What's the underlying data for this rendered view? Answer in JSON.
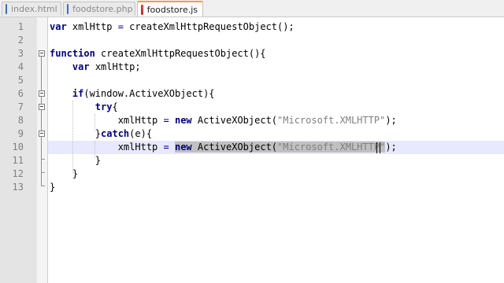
{
  "tabs": [
    {
      "label": "index.html",
      "icon": "document-icon",
      "active": false
    },
    {
      "label": "foodstore.php",
      "icon": "document-icon",
      "active": false
    },
    {
      "label": "foodstore.js",
      "icon": "document-icon",
      "active": true
    }
  ],
  "colors": {
    "keyword": "#000080",
    "string": "#808080",
    "current_line": "#e8e8ff",
    "selection": "#c0c0c0",
    "active_tab_accent": "#f0a040"
  },
  "current_line": 10,
  "lines": [
    {
      "n": "1",
      "segments": [
        {
          "t": "var ",
          "c": "kw"
        },
        {
          "t": "xmlHttp "
        },
        {
          "t": "=",
          "c": "op"
        },
        {
          "t": " createXmlHttpRequestObject();"
        }
      ]
    },
    {
      "n": "2",
      "segments": []
    },
    {
      "n": "3",
      "segments": [
        {
          "t": "function",
          "c": "kw"
        },
        {
          "t": " createXmlHttpRequestObject(){"
        }
      ]
    },
    {
      "n": "4",
      "segments": [
        {
          "t": "    "
        },
        {
          "t": "var",
          "c": "kw"
        },
        {
          "t": " xmlHttp;"
        }
      ]
    },
    {
      "n": "5",
      "segments": []
    },
    {
      "n": "6",
      "segments": [
        {
          "t": "    "
        },
        {
          "t": "if",
          "c": "kw"
        },
        {
          "t": "(window.ActiveXObject){"
        }
      ]
    },
    {
      "n": "7",
      "segments": [
        {
          "t": "        "
        },
        {
          "t": "try",
          "c": "kw"
        },
        {
          "t": "{"
        }
      ]
    },
    {
      "n": "8",
      "segments": [
        {
          "t": "            xmlHttp "
        },
        {
          "t": "=",
          "c": "op"
        },
        {
          "t": " "
        },
        {
          "t": "new",
          "c": "kw"
        },
        {
          "t": " ActiveXObject("
        },
        {
          "t": "\"Microsoft.XMLHTTP\"",
          "c": "str"
        },
        {
          "t": ");"
        }
      ]
    },
    {
      "n": "9",
      "segments": [
        {
          "t": "        }"
        },
        {
          "t": "catch",
          "c": "kw"
        },
        {
          "t": "(e){"
        }
      ]
    },
    {
      "n": "10",
      "segments": [
        {
          "t": "            xmlHttp "
        },
        {
          "t": "=",
          "c": "op"
        },
        {
          "t": " "
        },
        {
          "t": "new",
          "c": "kw sel"
        },
        {
          "t": " ActiveXObject(",
          "c": "sel"
        },
        {
          "t": "\"Microsoft.XMLHTTP\"",
          "c": "str sel"
        },
        {
          "t": ");"
        }
      ]
    },
    {
      "n": "11",
      "segments": [
        {
          "t": "        }"
        }
      ]
    },
    {
      "n": "12",
      "segments": [
        {
          "t": "    }"
        }
      ]
    },
    {
      "n": "13",
      "segments": [
        {
          "t": "}"
        }
      ]
    }
  ]
}
